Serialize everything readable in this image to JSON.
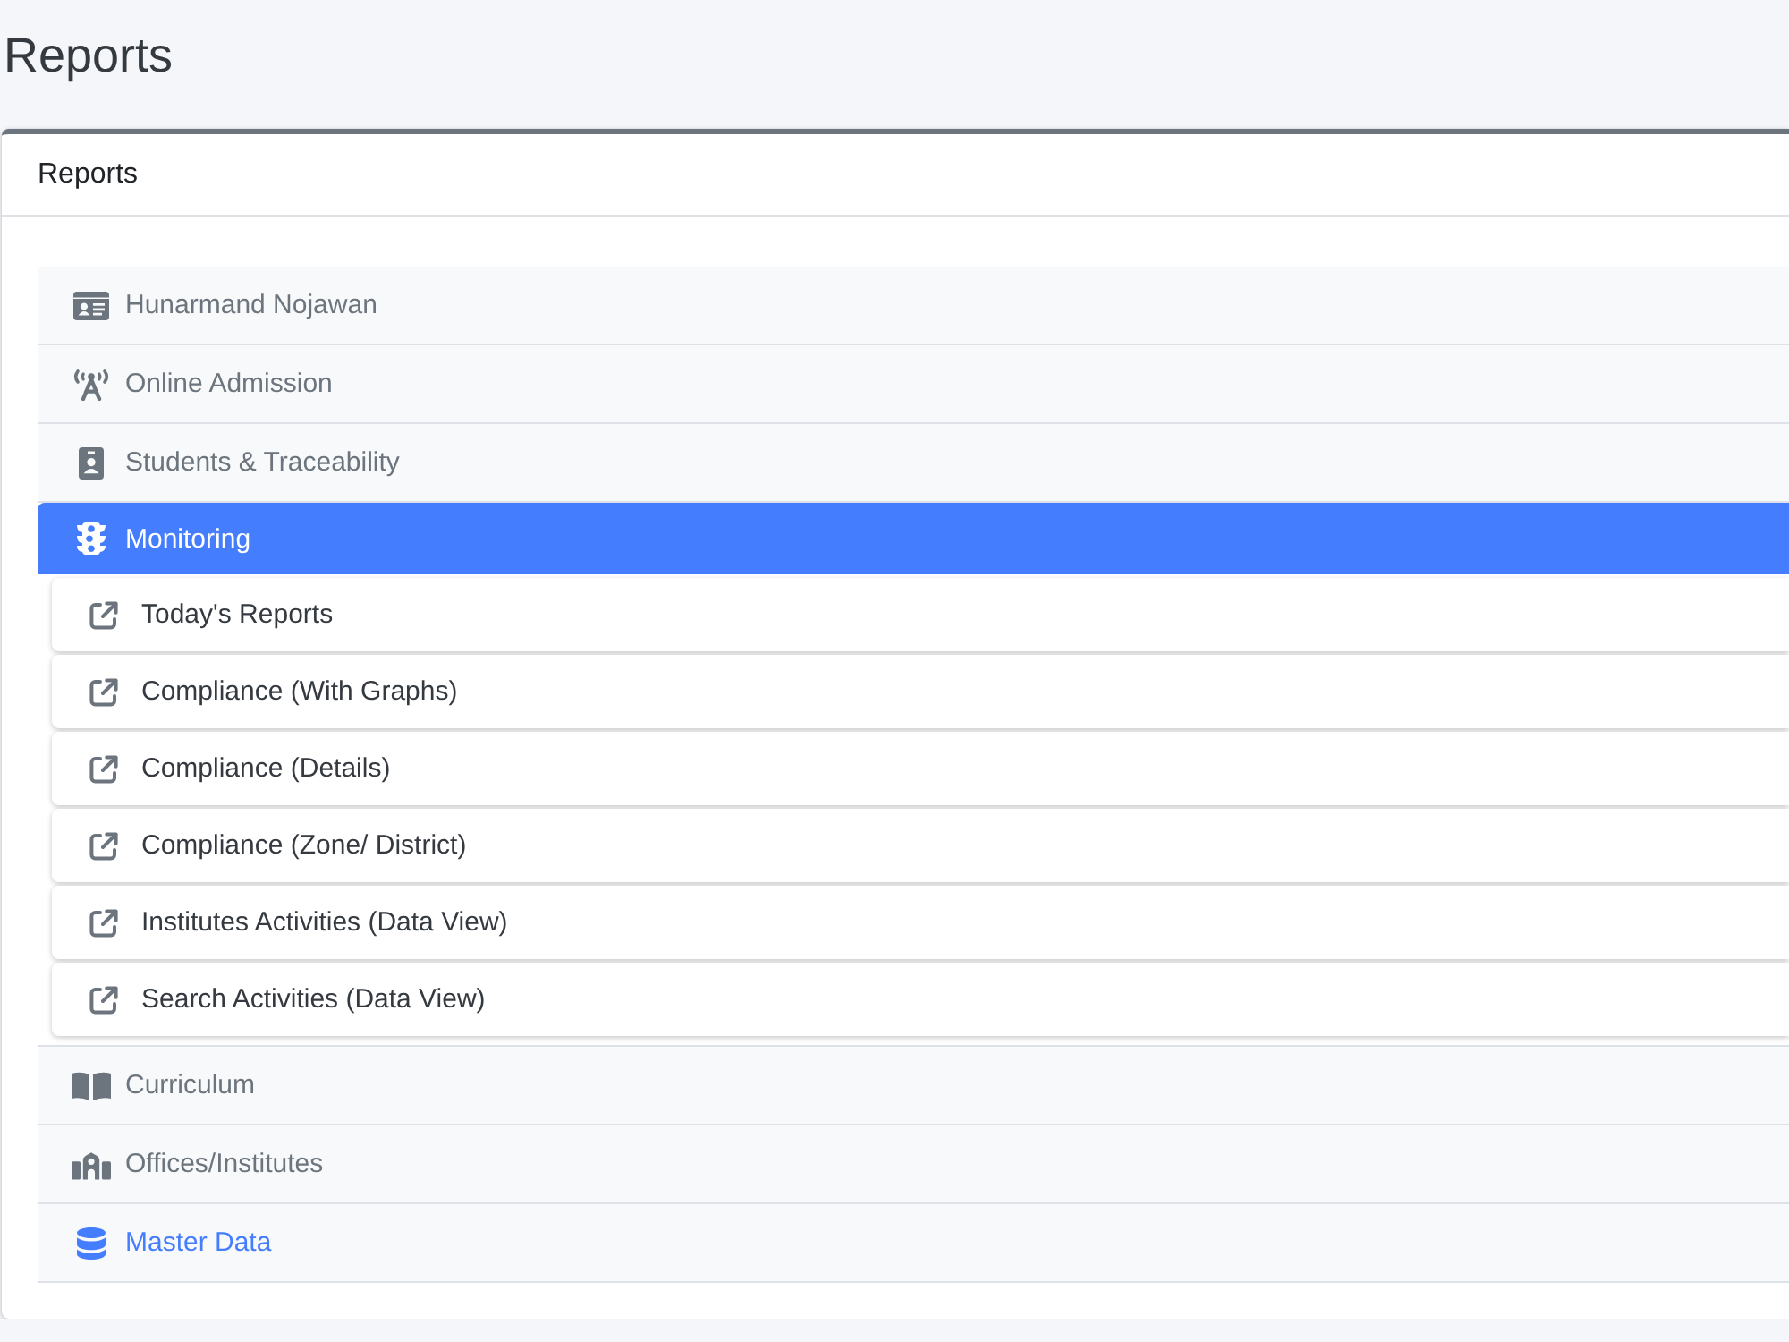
{
  "page_title": "Reports",
  "card": {
    "title": "Reports",
    "menu": [
      {
        "label": "Hunarmand Nojawan",
        "selected": false,
        "highlighted": false
      },
      {
        "label": "Online Admission",
        "selected": false,
        "highlighted": false
      },
      {
        "label": "Students & Traceability",
        "selected": false,
        "highlighted": false
      },
      {
        "label": "Monitoring",
        "selected": true,
        "highlighted": false,
        "children": [
          {
            "label": "Today's Reports"
          },
          {
            "label": "Compliance (With Graphs)"
          },
          {
            "label": "Compliance (Details)"
          },
          {
            "label": "Compliance (Zone/ District)"
          },
          {
            "label": "Institutes Activities (Data View)"
          },
          {
            "label": "Search Activities (Data View)"
          }
        ]
      },
      {
        "label": "Curriculum",
        "selected": false,
        "highlighted": false
      },
      {
        "label": "Offices/Institutes",
        "selected": false,
        "highlighted": false
      },
      {
        "label": "Master Data",
        "selected": false,
        "highlighted": true
      }
    ]
  }
}
